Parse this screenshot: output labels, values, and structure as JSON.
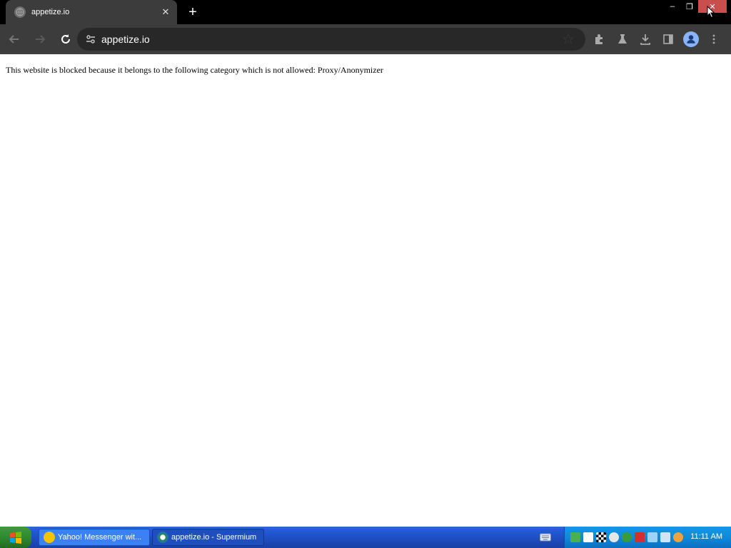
{
  "browser": {
    "tab": {
      "title": "appetize.io",
      "close_glyph": "✕"
    },
    "new_tab_glyph": "+",
    "window_controls": {
      "minimize": "–",
      "restore": "❐",
      "close": "✕"
    },
    "omnibox": {
      "url": "appetize.io"
    }
  },
  "page": {
    "message": "This website is blocked because it belongs to the following category which is not allowed: Proxy/Anonymizer"
  },
  "taskbar": {
    "tasks": [
      {
        "label": "Yahoo! Messenger wit..."
      },
      {
        "label": "appetize.io - Supermium"
      }
    ],
    "clock": "11:11 AM"
  },
  "colors": {
    "titlebar": "#000000",
    "toolbar": "#3c3c3c",
    "omnibox": "#282828",
    "close_button": "#c94f4f",
    "taskbar_blue": "#245edb",
    "start_green": "#2f8a2f"
  }
}
